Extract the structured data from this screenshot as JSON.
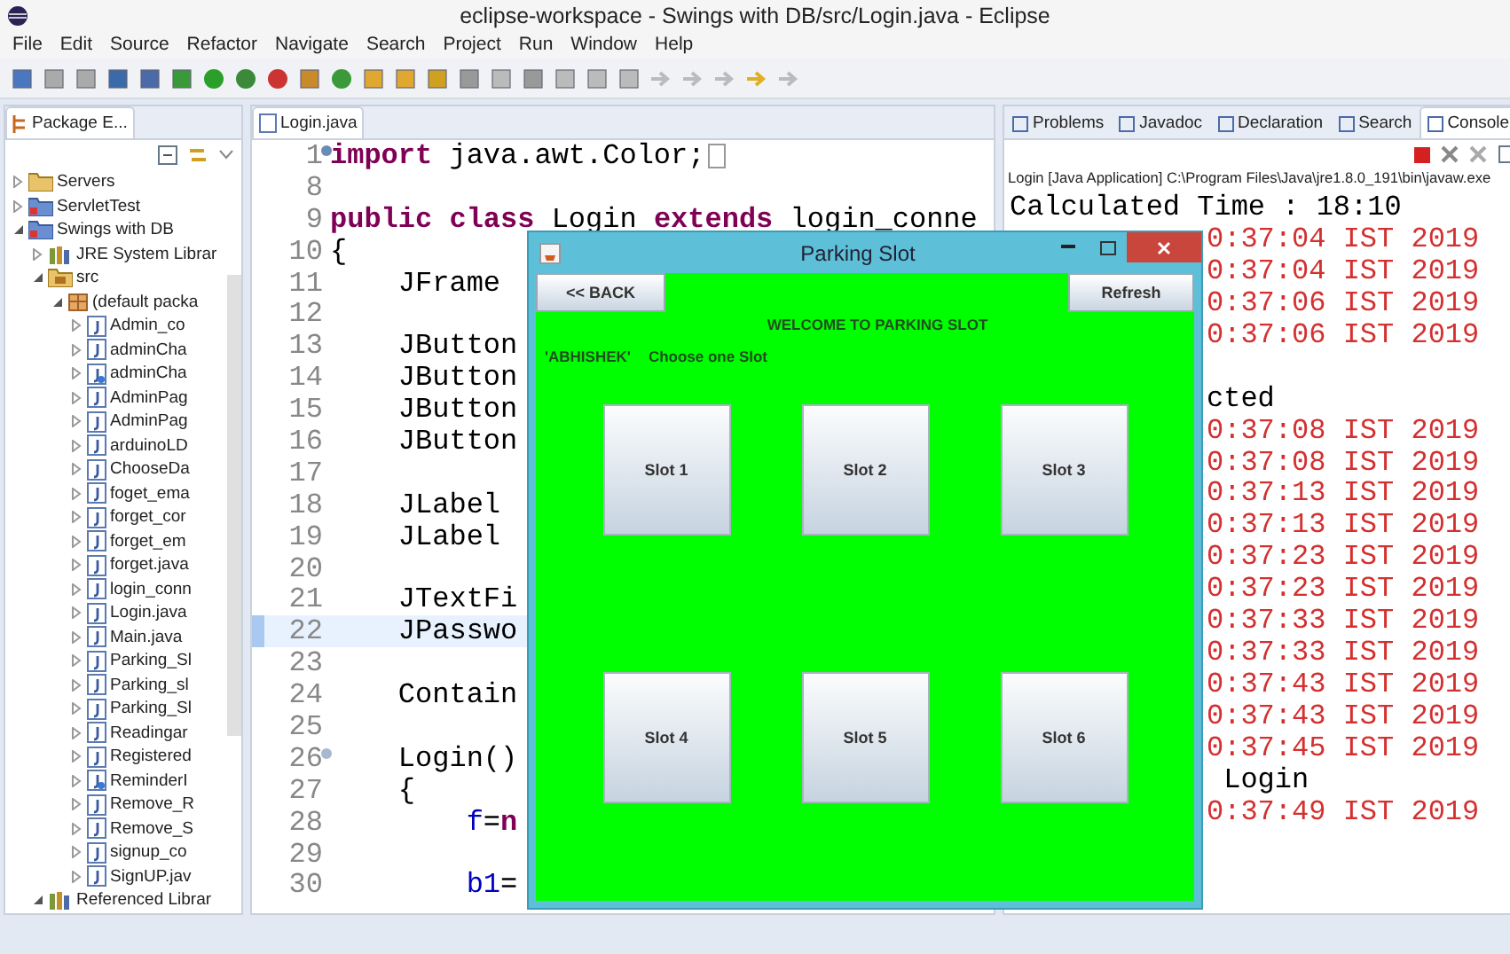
{
  "window": {
    "title": "eclipse-workspace - Swings with DB/src/Login.java - Eclipse"
  },
  "menu": [
    "File",
    "Edit",
    "Source",
    "Refactor",
    "Navigate",
    "Search",
    "Project",
    "Run",
    "Window",
    "Help"
  ],
  "package_explorer": {
    "tab": {
      "label": "Package E...",
      "selected": true
    },
    "tree": [
      {
        "label": "Servers",
        "kind": "folder",
        "expanded": false
      },
      {
        "label": "ServletTest",
        "kind": "project",
        "expanded": false
      },
      {
        "label": "Swings with DB",
        "kind": "project",
        "expanded": true,
        "children": [
          {
            "label": "JRE System Librar",
            "kind": "library",
            "expanded": false
          },
          {
            "label": "src",
            "kind": "source",
            "expanded": true,
            "children": [
              {
                "label": "(default packa",
                "kind": "package",
                "expanded": true,
                "children": [
                  {
                    "label": "Admin_co",
                    "kind": "java",
                    "expanded": false
                  },
                  {
                    "label": "adminCha",
                    "kind": "java",
                    "expanded": false
                  },
                  {
                    "label": "adminCha",
                    "kind": "java-main",
                    "expanded": false
                  },
                  {
                    "label": "AdminPag",
                    "kind": "java",
                    "expanded": false
                  },
                  {
                    "label": "AdminPag",
                    "kind": "java",
                    "expanded": false
                  },
                  {
                    "label": "arduinoLD",
                    "kind": "java",
                    "expanded": false
                  },
                  {
                    "label": "ChooseDa",
                    "kind": "java",
                    "expanded": false
                  },
                  {
                    "label": "foget_ema",
                    "kind": "java",
                    "expanded": false
                  },
                  {
                    "label": "forget_cor",
                    "kind": "java",
                    "expanded": false
                  },
                  {
                    "label": "forget_em",
                    "kind": "java",
                    "expanded": false
                  },
                  {
                    "label": "forget.java",
                    "kind": "java",
                    "expanded": false
                  },
                  {
                    "label": "login_conn",
                    "kind": "java",
                    "expanded": false
                  },
                  {
                    "label": "Login.java",
                    "kind": "java",
                    "expanded": false
                  },
                  {
                    "label": "Main.java",
                    "kind": "java",
                    "expanded": false
                  },
                  {
                    "label": "Parking_Sl",
                    "kind": "java",
                    "expanded": false
                  },
                  {
                    "label": "Parking_sl",
                    "kind": "java",
                    "expanded": false
                  },
                  {
                    "label": "Parking_Sl",
                    "kind": "java",
                    "expanded": false
                  },
                  {
                    "label": "Readingar",
                    "kind": "java",
                    "expanded": false
                  },
                  {
                    "label": "Registered",
                    "kind": "java",
                    "expanded": false
                  },
                  {
                    "label": "ReminderI",
                    "kind": "java-main",
                    "expanded": false
                  },
                  {
                    "label": "Remove_R",
                    "kind": "java",
                    "expanded": false
                  },
                  {
                    "label": "Remove_S",
                    "kind": "java",
                    "expanded": false
                  },
                  {
                    "label": "signup_co",
                    "kind": "java",
                    "expanded": false
                  },
                  {
                    "label": "SignUP.jav",
                    "kind": "java",
                    "expanded": false
                  }
                ]
              }
            ]
          },
          {
            "label": "Referenced Librar",
            "kind": "library",
            "expanded": true
          }
        ]
      }
    ]
  },
  "editor": {
    "tab": {
      "label": "Login.java",
      "selected": true
    },
    "lines": [
      {
        "number": "1",
        "kind": "collapsed-fold",
        "current": false,
        "tokens": [
          {
            "kind": "keyword",
            "text": "import"
          },
          {
            "kind": "plain",
            "text": " java.awt.Color;"
          }
        ]
      },
      {
        "number": "8",
        "kind": "plain",
        "current": false
      },
      {
        "number": "9",
        "kind": "plain",
        "current": false,
        "tokens": [
          {
            "kind": "keyword",
            "text": "public"
          },
          {
            "kind": "keyword",
            "text": " class"
          },
          {
            "kind": "plain",
            "text": " Login "
          },
          {
            "kind": "keyword",
            "text": "extends"
          },
          {
            "kind": "plain",
            "text": " login_conne"
          }
        ]
      },
      {
        "number": "10",
        "kind": "plain",
        "current": false,
        "tokens": [
          {
            "kind": "plain",
            "text": "{"
          }
        ]
      },
      {
        "number": "11",
        "kind": "plain",
        "current": false,
        "tokens": [
          {
            "kind": "plain",
            "text": "    JFrame"
          }
        ]
      },
      {
        "number": "12",
        "kind": "plain",
        "current": false
      },
      {
        "number": "13",
        "kind": "plain",
        "current": false,
        "tokens": [
          {
            "kind": "plain",
            "text": "    JButton"
          }
        ]
      },
      {
        "number": "14",
        "kind": "plain",
        "current": false,
        "tokens": [
          {
            "kind": "plain",
            "text": "    JButton"
          }
        ]
      },
      {
        "number": "15",
        "kind": "plain",
        "current": false,
        "tokens": [
          {
            "kind": "plain",
            "text": "    JButton"
          }
        ]
      },
      {
        "number": "16",
        "kind": "plain",
        "current": false,
        "tokens": [
          {
            "kind": "plain",
            "text": "    JButton"
          }
        ]
      },
      {
        "number": "17",
        "kind": "plain",
        "current": false
      },
      {
        "number": "18",
        "kind": "plain",
        "current": false,
        "tokens": [
          {
            "kind": "plain",
            "text": "    JLabel"
          }
        ]
      },
      {
        "number": "19",
        "kind": "plain",
        "current": false,
        "tokens": [
          {
            "kind": "plain",
            "text": "    JLabel"
          }
        ]
      },
      {
        "number": "20",
        "kind": "plain",
        "current": false
      },
      {
        "number": "21",
        "kind": "plain",
        "current": false,
        "tokens": [
          {
            "kind": "plain",
            "text": "    JTextFi"
          }
        ]
      },
      {
        "number": "22",
        "kind": "plain",
        "current": true,
        "tokens": [
          {
            "kind": "plain",
            "text": "    JPasswo"
          }
        ]
      },
      {
        "number": "23",
        "kind": "plain",
        "current": false
      },
      {
        "number": "24",
        "kind": "plain",
        "current": false,
        "tokens": [
          {
            "kind": "plain",
            "text": "    Contain"
          }
        ]
      },
      {
        "number": "25",
        "kind": "plain",
        "current": false
      },
      {
        "number": "26",
        "kind": "expanded-fold",
        "current": false,
        "tokens": [
          {
            "kind": "plain",
            "text": "    Login()"
          }
        ]
      },
      {
        "number": "27",
        "kind": "plain",
        "current": false,
        "tokens": [
          {
            "kind": "plain",
            "text": "    {"
          }
        ]
      },
      {
        "number": "28",
        "kind": "plain",
        "current": false,
        "tokens": [
          {
            "kind": "field",
            "text": "        f"
          },
          {
            "kind": "plain",
            "text": "="
          },
          {
            "kind": "keyword",
            "text": "n"
          }
        ]
      },
      {
        "number": "29",
        "kind": "plain",
        "current": false
      },
      {
        "number": "30",
        "kind": "plain",
        "current": false,
        "tokens": [
          {
            "kind": "field",
            "text": "        b1"
          },
          {
            "kind": "plain",
            "text": "="
          }
        ]
      }
    ]
  },
  "console_panel": {
    "tabs": [
      {
        "label": "Problems",
        "selected": false
      },
      {
        "label": "Javadoc",
        "selected": false
      },
      {
        "label": "Declaration",
        "selected": false
      },
      {
        "label": "Search",
        "selected": false
      },
      {
        "label": "Console",
        "selected": true
      }
    ],
    "process": "Login [Java Application] C:\\Program Files\\Java\\jre1.8.0_191\\bin\\javaw.exe",
    "lines": [
      {
        "kind": "stdout",
        "covered": false,
        "text": "Calculated Time : 18:10"
      },
      {
        "kind": "stderr",
        "covered": true,
        "text": "0:37:04 IST 2019"
      },
      {
        "kind": "stderr",
        "covered": true,
        "text": "0:37:04 IST 2019"
      },
      {
        "kind": "stderr",
        "covered": true,
        "text": "0:37:06 IST 2019"
      },
      {
        "kind": "stderr",
        "covered": true,
        "text": "0:37:06 IST 2019"
      },
      {
        "kind": "blank"
      },
      {
        "kind": "stdout",
        "covered": true,
        "text": "cted"
      },
      {
        "kind": "stderr",
        "covered": true,
        "text": "0:37:08 IST 2019"
      },
      {
        "kind": "stderr",
        "covered": true,
        "text": "0:37:08 IST 2019"
      },
      {
        "kind": "stderr",
        "covered": true,
        "text": "0:37:13 IST 2019"
      },
      {
        "kind": "stderr",
        "covered": true,
        "text": "0:37:13 IST 2019"
      },
      {
        "kind": "stderr",
        "covered": true,
        "text": "0:37:23 IST 2019"
      },
      {
        "kind": "stderr",
        "covered": true,
        "text": "0:37:23 IST 2019"
      },
      {
        "kind": "stderr",
        "covered": true,
        "text": "0:37:33 IST 2019"
      },
      {
        "kind": "stderr",
        "covered": true,
        "text": "0:37:33 IST 2019"
      },
      {
        "kind": "stderr",
        "covered": true,
        "text": "0:37:43 IST 2019"
      },
      {
        "kind": "stderr",
        "covered": true,
        "text": "0:37:43 IST 2019"
      },
      {
        "kind": "stderr",
        "covered": true,
        "text": "0:37:45 IST 2019"
      },
      {
        "kind": "stdout",
        "covered": true,
        "text": " Login"
      },
      {
        "kind": "stderr",
        "covered": true,
        "text": "0:37:49 IST 2019"
      }
    ]
  },
  "dialog": {
    "title": "Parking Slot",
    "back_button": "<< BACK",
    "refresh_button": "Refresh",
    "welcome": "WELCOME TO PARKING SLOT",
    "user": "'ABHISHEK'",
    "prompt": "Choose one Slot",
    "slots": [
      "Slot 1",
      "Slot 2",
      "Slot 3",
      "Slot 4",
      "Slot 5",
      "Slot 6"
    ]
  }
}
